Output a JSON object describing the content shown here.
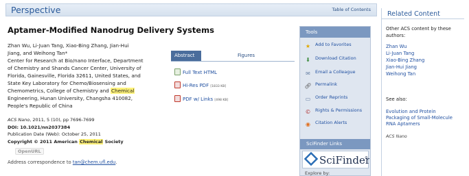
{
  "header": {
    "title": "Perspective",
    "toc_link": "Table of Contents"
  },
  "article": {
    "title": "Aptamer-Modified Nanodrug Delivery Systems",
    "authors_line1": "Zhan Wu, Li-Juan Tang, Xiao-Bing Zhang, Jian-Hui",
    "authors_line2": "Jiang, and Weihong Tan*",
    "affil_1": "Center for Research at Bio/nano Interface, Department",
    "affil_2": "of Chemistry and Shands Cancer Center, University of",
    "affil_3": "Florida, Gainesville, Florida 32611, United States, and",
    "affil_4": "State Key Laboratory for Chemo/Biosensing and",
    "affil_5a": "Chemometrics, College of Chemistry and ",
    "affil_5b": "Chemical",
    "affil_6": "Engineering, Hunan University, Changsha 410082,",
    "affil_7": "People's Republic of China",
    "journal": "ACS Nano",
    "citation": ", 2011, 5 (10), pp 7696-7699",
    "doi": "DOI: 10.1021/nn2037384",
    "pub_date": "Publication Date (Web): October 25, 2011",
    "copyright_a": "Copyright © 2011 American ",
    "copyright_b": "Chemical",
    "copyright_c": " Society",
    "openurl": "OpenURL",
    "addr_prefix": "Address correspondence to ",
    "addr_email": "tan@chem.ufl.edu",
    "addr_suffix": "."
  },
  "tabs": {
    "abstract": "Abstract",
    "figures": "Figures"
  },
  "downloads": {
    "full_text": "Full Text HTML",
    "hires_pdf": "Hi-Res PDF",
    "hires_size": "[1833 KB]",
    "pdf_links": "PDF w/ Links",
    "pdf_links_size": "[498 KB]"
  },
  "tools": {
    "header": "Tools",
    "items": [
      "Add to Favorites",
      "Download Citation",
      "Email a Colleague",
      "Permalink",
      "Order Reprints",
      "Rights & Permissions",
      "Citation Alerts"
    ],
    "icons": [
      "star-icon",
      "download-icon",
      "envelope-icon",
      "link-icon",
      "document-icon",
      "copyright-icon",
      "rss-icon"
    ]
  },
  "scifinder": {
    "header": "SciFinder Links",
    "logo": "SciFinder",
    "reg": "®",
    "explore": "Explore by:"
  },
  "related": {
    "title": "Related Content",
    "other_1": "Other ACS content by these",
    "other_2": "authors:",
    "authors": [
      "Zhan Wu",
      "Li-Juan Tang",
      "Xiao-Bing Zhang",
      "Jian-Hui Jiang",
      "Weihong Tan"
    ],
    "see_also": "See also:",
    "rel_1": "Evolution and Protein",
    "rel_2": "Packaging of Small-Molecule",
    "rel_3": "RNA Aptamers",
    "rel_journal": "ACS Nano"
  },
  "colors": {
    "link": "#1f4fa0",
    "header_bg": "#dde6f2",
    "tools_bg": "#dfe6f0",
    "tools_hdr": "#7b98c0",
    "highlight": "#fff27a"
  }
}
